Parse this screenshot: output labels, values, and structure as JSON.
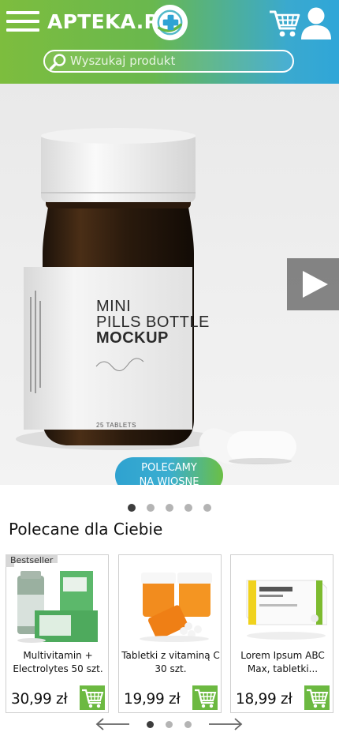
{
  "header": {
    "logo_text": "APTEKA.PL",
    "search_placeholder": "Wyszukaj produkt",
    "icons": [
      "menu-icon",
      "logo-badge-icon",
      "cart-icon",
      "user-icon",
      "search-icon"
    ]
  },
  "hero": {
    "bottle_label": {
      "line1": "MINI",
      "line2": "PILLS BOTTLE",
      "line3": "MOCKUP",
      "tablets": "25 TABLETS"
    },
    "promo_line1": "POLECAMY",
    "promo_line2": "NA WIOSNĘ",
    "slide_count": 5,
    "active_slide": 1
  },
  "recommended": {
    "title": "Polecane dla Ciebie",
    "products": [
      {
        "badge": "Bestseller",
        "name": "Multivitamin + Electrolytes 50 szt.",
        "price": "30,99 zł"
      },
      {
        "badge": "",
        "name": "Tabletki z vitaminą C 30 szt.",
        "price": "19,99 zł"
      },
      {
        "badge": "",
        "name": "Lorem Ipsum ABC Max, tabletki...",
        "price": "18,99 zł"
      }
    ],
    "page_count": 3,
    "active_page": 1
  },
  "colors": {
    "header_green": "#7dbd3e",
    "header_blue": "#2fa6d8",
    "add_to_cart_green": "#6cb941",
    "active_dot": "#3d3d3d",
    "inactive_dot": "#b4b4b4"
  }
}
